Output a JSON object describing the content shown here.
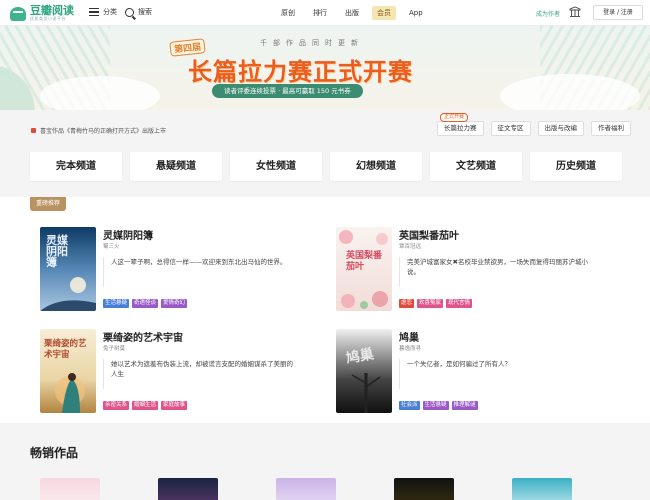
{
  "header": {
    "logo_name": "豆瓣阅读",
    "logo_sub": "优质类型小说平台",
    "category_label": "分类",
    "search_label": "搜索",
    "tabs": [
      "原创",
      "排行",
      "出版",
      "会员",
      "App"
    ],
    "active_tab": "会员",
    "become_author": "成为作者",
    "login": "登录 / 注册"
  },
  "banner": {
    "edition": "第四届",
    "top_line": "千部作品同时更新",
    "title": "长篇拉力赛正式开赛",
    "pill": "读者评委连续投票 · 最高可赢取 150 元书券"
  },
  "notice": {
    "text": "喜宝作品《青梅竹马的正确打开方式》出版上市"
  },
  "quick_links": {
    "badge": "正式开赛",
    "items": [
      "长篇拉力赛",
      "征文专区",
      "出版与改编",
      "作者福利"
    ]
  },
  "channels": [
    "完本频道",
    "悬疑频道",
    "女性频道",
    "幻想频道",
    "文艺频道",
    "历史频道"
  ],
  "recommend": {
    "label": "重磅推荐",
    "books": [
      {
        "title": "灵媒阴阳簿",
        "author": "蜀三火",
        "desc": "人这一辈子啊，总得信一样——欢迎来到东北出马仙的世界。",
        "tags": [
          "生活悬疑",
          "奇遇怪谈",
          "爱情奇幻"
        ],
        "cover_text": "灵媒阴阳簿"
      },
      {
        "title": "英国梨番茄叶",
        "author": "覃百冠远",
        "desc": "完美沪城富家女✖名校毕业禁欲男，一场失而复得玛丽苏沪城小说。",
        "tags": [
          "虐恋",
          "欢喜冤家",
          "现代言情"
        ],
        "cover_text": "英国梨番茄叶"
      },
      {
        "title": "栗绮姿的艺术宇宙",
        "author": "兔子树莫",
        "desc": "她以艺术为遮羞布伪装上流，却被谎言支配的婚姻谋杀了美丽的人生",
        "tags": [
          "亲密关系",
          "婚姻生活",
          "家庭故事"
        ],
        "cover_text": "栗绮姿的艺术宇宙"
      },
      {
        "title": "鸠巢",
        "author": "暮逸而寻",
        "desc": "一个失亿者，是如何骗过了所有人？",
        "tags": [
          "社会派",
          "生活悬疑",
          "推理解谜"
        ],
        "cover_text": "鸠巢"
      }
    ]
  },
  "bestseller": {
    "title": "畅销作品"
  },
  "colors": {
    "brand": "#2fa57f",
    "banner_title": "#ec5b1f",
    "rec_label": "#b89260",
    "tag_blue": "#4a7fd9",
    "tag_pink": "#e0548c",
    "tag_purple": "#9b59c8",
    "tag_red": "#e04b3a",
    "tag_green": "#3aa886"
  }
}
